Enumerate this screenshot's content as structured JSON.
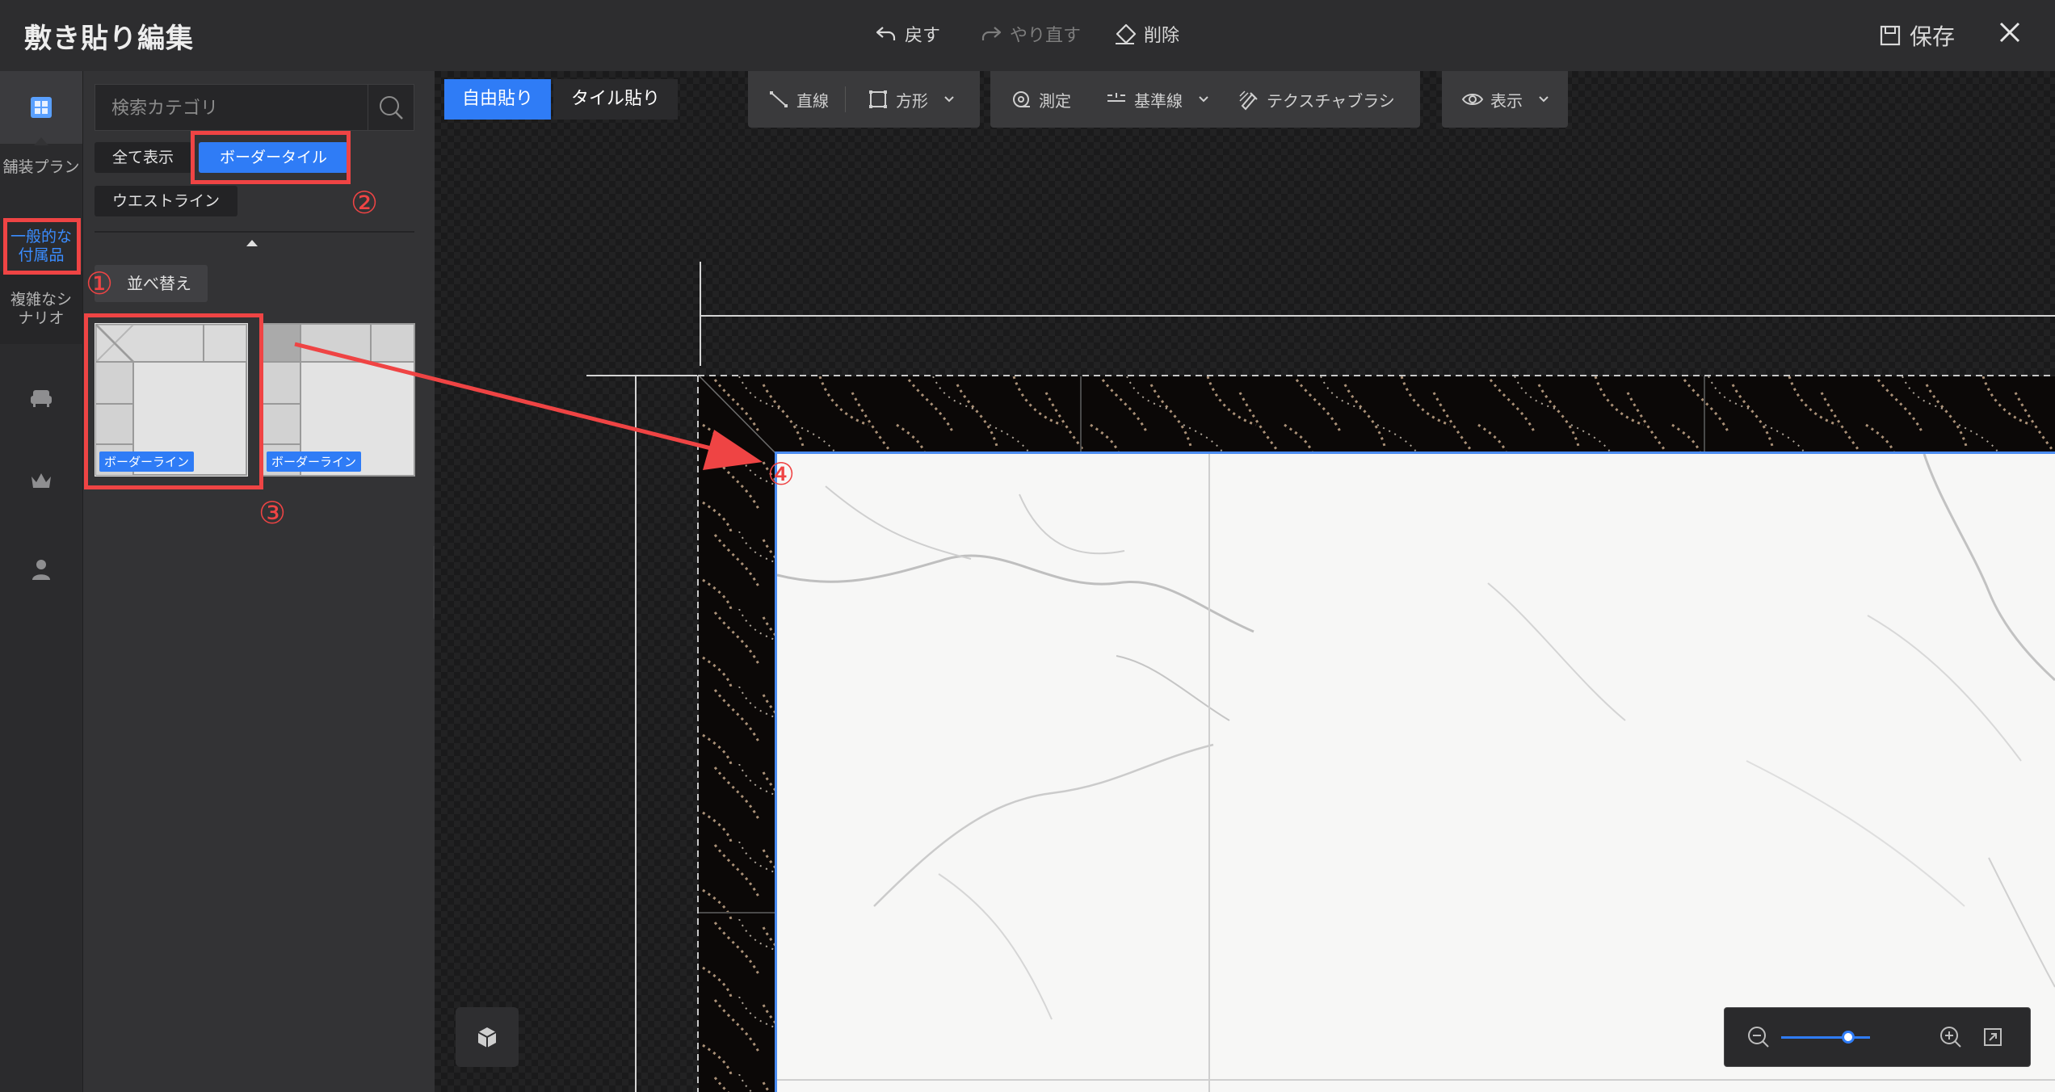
{
  "app": {
    "title": "敷き貼り編集",
    "undo_label": "戻す",
    "redo_label": "やり直す",
    "delete_label": "削除",
    "save_label": "保存"
  },
  "rail": {
    "items": [
      {
        "label": "舗装プラン"
      },
      {
        "label": "一般的な付属品"
      },
      {
        "label": "複雑なシナリオ"
      }
    ]
  },
  "panel": {
    "search_placeholder": "検索カテゴリ",
    "chips": [
      "全て表示",
      "ボーダータイル",
      "ウエストライン"
    ],
    "sort_label": "並べ替え",
    "tiles": [
      {
        "badge": "ボーダーライン"
      },
      {
        "badge": "ボーダーライン"
      }
    ]
  },
  "canvas": {
    "mode_free": "自由貼り",
    "mode_tile": "タイル貼り",
    "tools": {
      "line": "直線",
      "rect": "方形",
      "measure": "測定",
      "baseline": "基準線",
      "texture_brush": "テクスチャブラシ",
      "display": "表示"
    },
    "zoom_level": 0.75
  },
  "annotations": [
    "①",
    "②",
    "③",
    "④"
  ],
  "colors": {
    "accent": "#2f7cf6",
    "annotation": "#ef4444",
    "topbar": "#2d2d2f",
    "panel": "#333335"
  }
}
